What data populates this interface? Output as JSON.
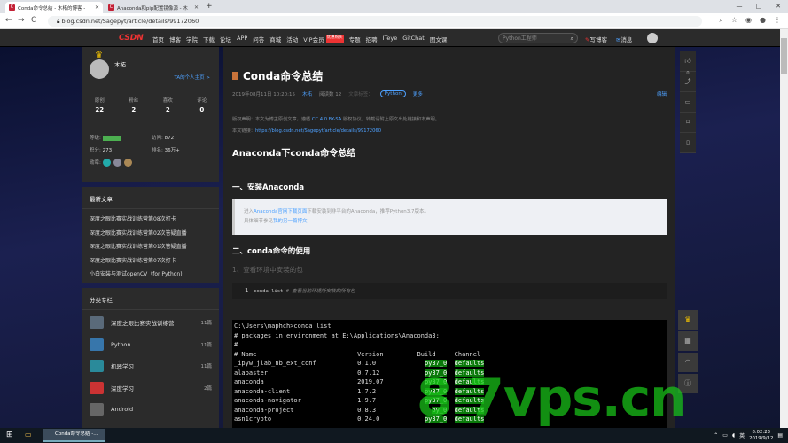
{
  "browser": {
    "tabs": [
      {
        "label": "Conda命令总结 - 木柘的博客 - ",
        "favicon": "C",
        "active": true
      },
      {
        "label": "Anaconda和pip配置镜像源 - 木",
        "favicon": "C",
        "active": false
      }
    ],
    "new_tab": "+",
    "url": "blog.csdn.net/Sagepyt/article/details/99172060",
    "nav": {
      "back": "←",
      "forward": "→",
      "reload": "C"
    },
    "window_controls": [
      "—",
      "□",
      "✕"
    ]
  },
  "csdn": {
    "logo": "CSDN",
    "menu": [
      "首页",
      "博客",
      "学院",
      "下载",
      "论坛",
      "APP",
      "问答",
      "商城",
      "活动",
      "VIP会员",
      "专题",
      "招聘",
      "ITeye",
      "GitChat",
      "图文课"
    ],
    "vip_hot": "优惠购买",
    "search_placeholder": "Python工程师",
    "write_label": "写博客",
    "messages_label": "消息"
  },
  "profile": {
    "name": "木柘",
    "home_link": "TA的个人主页 >",
    "stats": [
      {
        "label": "原创",
        "value": "22"
      },
      {
        "label": "粉丝",
        "value": "2"
      },
      {
        "label": "喜欢",
        "value": "2"
      },
      {
        "label": "评论",
        "value": "0"
      }
    ],
    "level_label": "等级:",
    "visits_label": "访问:",
    "visits": "872",
    "points_label": "积分:",
    "points": "273",
    "rank_label": "排名:",
    "rank": "36万+",
    "badges_label": "勋章:"
  },
  "recent": {
    "title": "最新文章",
    "items": [
      "深度之眼比赛实战训练营第08次打卡",
      "深度之眼比赛实战训练营第02次答疑直播",
      "深度之眼比赛实战训练营第01次答疑直播",
      "深度之眼比赛实战训练营第07次打卡",
      "小白安装与测试openCV（for Python)"
    ]
  },
  "categories": {
    "title": "分类专栏",
    "items": [
      {
        "name": "深度之眼比赛实战训练营",
        "count": "11篇",
        "color": "#5a6a7a"
      },
      {
        "name": "Python",
        "count": "11篇",
        "color": "#3776ab"
      },
      {
        "name": "机器学习",
        "count": "11篇",
        "color": "#2a8a9a"
      },
      {
        "name": "深度学习",
        "count": "2篇",
        "color": "#c33"
      },
      {
        "name": "Android",
        "count": "",
        "color": "#666"
      }
    ]
  },
  "article": {
    "title": "Conda命令总结",
    "date": "2019年08月11日 10:20:15",
    "author": "木柘",
    "reads": "阅读数 12",
    "tags_label": "文章标签：",
    "tag": "Python",
    "more": "更多",
    "edit": "编辑",
    "copyright_text": "版权声明：本文为博主原创文章，遵循",
    "license": "CC 4.0 BY-SA",
    "copyright_tail": "版权协议，转载请附上原文出处链接和本声明。",
    "link_label": "本文链接：",
    "link": "https://blog.csdn.net/Sagepyt/article/details/99172060",
    "h1": "Anaconda下conda命令总结",
    "h2_1": "一、安装Anaconda",
    "quote_pre": "进入",
    "quote_link": "Anaconda官网下载页面",
    "quote_mid": "下载安装到非平台的Anaconda，推荐Python3.7版本。",
    "quote2_pre": "具体细节参见",
    "quote2_link": "我的另一篇博文",
    "h2_2": "二、conda命令的使用",
    "h3": "1、查看环境中安装的包",
    "code_line_no": "1",
    "code_cmd": "conda list",
    "code_comment": "# 查看当前环境所安装的所有包"
  },
  "terminal": {
    "prompt": "C:\\Users\\maphch>conda list",
    "header1": "# packages in environment at E:\\Applications\\Anaconda3:",
    "header2": "#",
    "columns": [
      "# Name",
      "Version",
      "Build",
      "Channel"
    ],
    "rows": [
      [
        "_ipyw_jlab_nb_ext_conf",
        "0.1.0",
        "py37_0",
        "defaults"
      ],
      [
        "alabaster",
        "0.7.12",
        "py37_0",
        "defaults"
      ],
      [
        "anaconda",
        "2019.07",
        "py37_0",
        "defaults"
      ],
      [
        "anaconda-client",
        "1.7.2",
        "py37_0",
        "defaults"
      ],
      [
        "anaconda-navigator",
        "1.9.7",
        "py37_0",
        "defaults"
      ],
      [
        "anaconda-project",
        "0.8.3",
        "py_0",
        "defaults"
      ],
      [
        "asn1crypto",
        "0.24.0",
        "py37_0",
        "defaults"
      ]
    ]
  },
  "right_tools": {
    "like_count": "0"
  },
  "watermark": "8   7vps.cn",
  "taskbar": {
    "task": "Conda命令总结 -...",
    "ime": "英",
    "time": "8:02:23",
    "date": "2019/9/12"
  }
}
